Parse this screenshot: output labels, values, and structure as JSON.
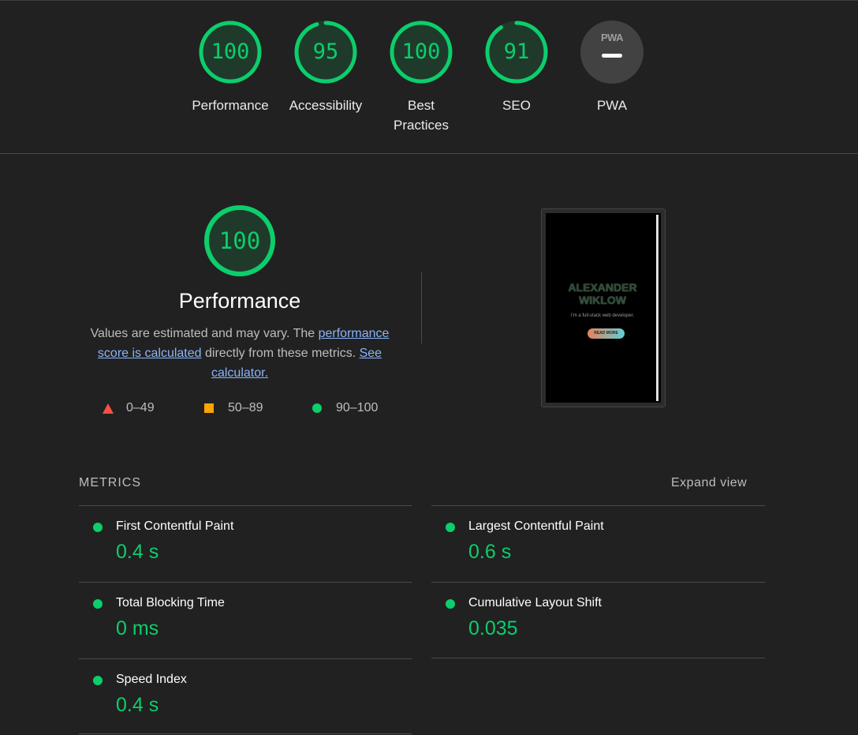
{
  "summary": {
    "gauges": [
      {
        "score": "100",
        "label": "Performance",
        "fraction": 1.0,
        "color": "#0cce6b"
      },
      {
        "score": "95",
        "label": "Accessibility",
        "fraction": 0.95,
        "color": "#0cce6b"
      },
      {
        "score": "100",
        "label": "Best Practices",
        "fraction": 1.0,
        "color": "#0cce6b"
      },
      {
        "score": "91",
        "label": "SEO",
        "fraction": 0.91,
        "color": "#0cce6b"
      }
    ],
    "pwa": {
      "badge_text": "PWA",
      "label": "PWA",
      "icon": "pwa-dash-icon"
    }
  },
  "performance": {
    "score": "100",
    "fraction": 1.0,
    "title": "Performance",
    "desc_1": "Values are estimated and may vary. The ",
    "desc_link_1": "performance score is calculated",
    "desc_2": " directly from these metrics. ",
    "desc_link_2": "See calculator.",
    "legend": [
      {
        "range": "0–49",
        "shape": "triangle",
        "color": "#ff4e42"
      },
      {
        "range": "50–89",
        "shape": "square",
        "color": "#ffa400"
      },
      {
        "range": "90–100",
        "shape": "circle",
        "color": "#0cce6b"
      }
    ]
  },
  "screenshot": {
    "name": "ALEXANDER WIKLOW",
    "subtitle": "I'm a full-stack web developer.",
    "button": "READ MORE"
  },
  "metrics": {
    "header": "METRICS",
    "expand": "Expand view",
    "items": [
      {
        "title": "First Contentful Paint",
        "value": "0.4 s",
        "status_color": "#0cce6b"
      },
      {
        "title": "Largest Contentful Paint",
        "value": "0.6 s",
        "status_color": "#0cce6b"
      },
      {
        "title": "Total Blocking Time",
        "value": "0 ms",
        "status_color": "#0cce6b"
      },
      {
        "title": "Cumulative Layout Shift",
        "value": "0.035",
        "status_color": "#0cce6b"
      },
      {
        "title": "Speed Index",
        "value": "0.4 s",
        "status_color": "#0cce6b"
      }
    ]
  }
}
